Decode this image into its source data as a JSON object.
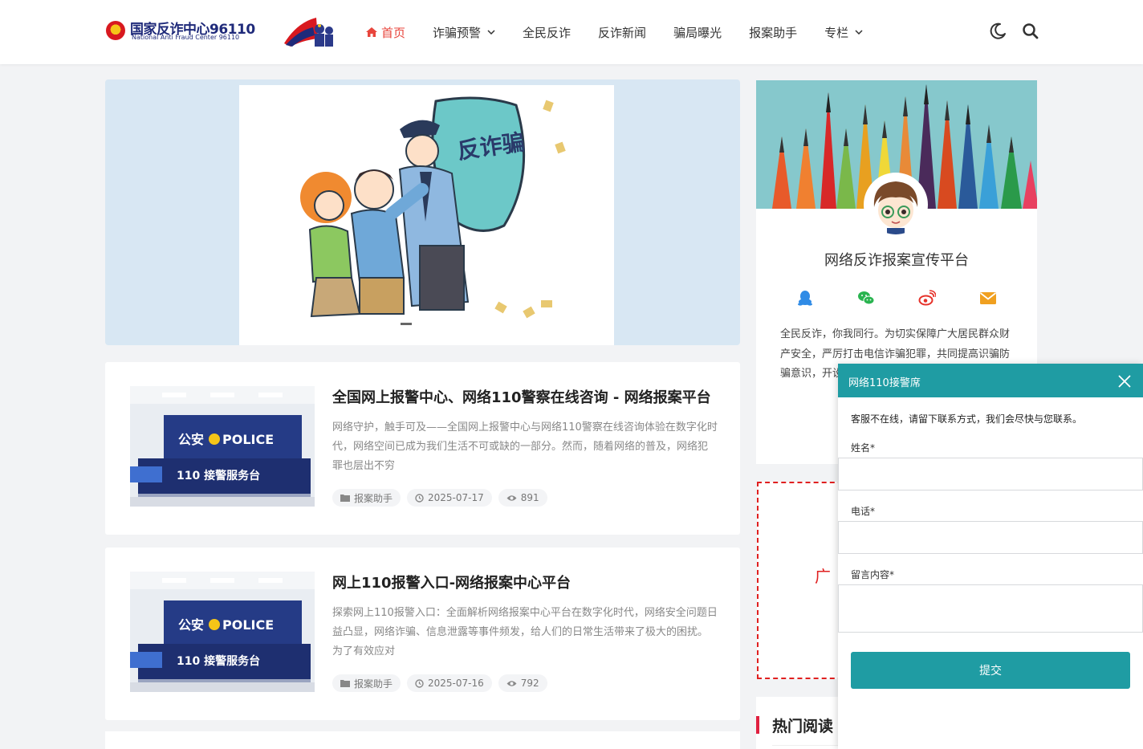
{
  "header": {
    "logo_cn": "国家反诈中心96110",
    "logo_en": "National Anti Fraud Center 96110",
    "nav": [
      {
        "label": "首页"
      },
      {
        "label": "诈骗预警"
      },
      {
        "label": "全民反诈"
      },
      {
        "label": "反诈新闻"
      },
      {
        "label": "骗局曝光"
      },
      {
        "label": "报案助手"
      },
      {
        "label": "专栏"
      }
    ]
  },
  "banner": {
    "shield_text": "反诈骗"
  },
  "posts": [
    {
      "title": "全国网上报警中心、网络110警察在线咨询 - 网络报案平台",
      "excerpt": "网络守护，触手可及——全国网上报警中心与网络110警察在线咨询体验在数字化时代，网络空间已成为我们生活不可或缺的一部分。然而，随着网络的普及，网络犯罪也层出不穷",
      "category": "报案助手",
      "date": "2025-07-17",
      "views": "891",
      "thumb_top": "公安",
      "thumb_police": "POLICE",
      "thumb_bottom": "110 接警服务台"
    },
    {
      "title": "网上110报警入口-网络报案中心平台",
      "excerpt": "探索网上110报警入口：全面解析网络报案中心平台在数字化时代，网络安全问题日益凸显，网络诈骗、信息泄露等事件频发，给人们的日常生活带来了极大的困扰。为了有效应对",
      "category": "报案助手",
      "date": "2025-07-16",
      "views": "792",
      "thumb_top": "公安",
      "thumb_police": "POLICE",
      "thumb_bottom": "110 接警服务台"
    }
  ],
  "profile": {
    "name": "网络反诈报案宣传平台",
    "description": "全民反诈，你我同行。为切实保障广大居民群众财产安全，严厉打击电信诈骗犯罪，共同提高识骗防骗意识，开设【反诈...民反诈”的...络诈骗防线..."
  },
  "ad": {
    "text": "广"
  },
  "hot": {
    "title": "热门阅读"
  },
  "chat": {
    "title": "网络110接警席",
    "note": "客服不在线，请留下联系方式，我们会尽快与您联系。",
    "name_label": "姓名*",
    "phone_label": "电话*",
    "message_label": "留言内容*",
    "submit_label": "提交"
  },
  "colors": {
    "accent": "#e8453c",
    "chat_teal": "#1f9ca3",
    "ad_red": "#e02020"
  }
}
